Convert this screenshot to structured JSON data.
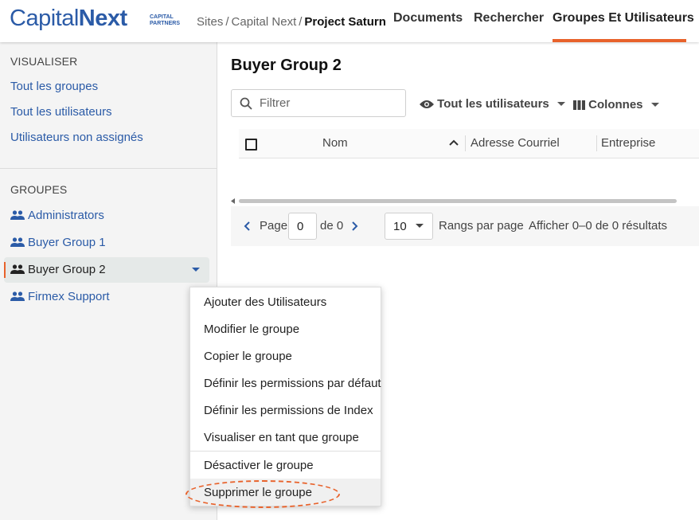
{
  "header": {
    "logo_regular": "Capital",
    "logo_bold": "Next",
    "logo_sub_line1": "CAPITAL",
    "logo_sub_line2": "PARTNERS",
    "breadcrumb": {
      "sites": "Sites",
      "sep": "/",
      "project": "Capital Next",
      "current": "Project Saturn"
    },
    "nav": {
      "documents": "Documents",
      "search": "Rechercher",
      "groups": "Groupes Et Utilisateurs"
    },
    "accent": "#e8622b"
  },
  "sidebar": {
    "view_heading": "VISUALISER",
    "view_links": [
      "Tout les groupes",
      "Tout les utilisateurs",
      "Utilisateurs non assignés"
    ],
    "groups_heading": "GROUPES",
    "groups": [
      "Administrators",
      "Buyer Group 1",
      "Buyer Group 2",
      "Firmex Support"
    ],
    "selected_group": "Buyer Group 2",
    "link_color": "#2b5ba7"
  },
  "main": {
    "title": "Buyer Group 2",
    "filter_placeholder": "Filtrer",
    "view_toggle": "Tout les utilisateurs",
    "columns_button": "Colonnes",
    "table_columns": [
      "Nom",
      "Adresse Courriel",
      "Entreprise"
    ],
    "pager": {
      "page_label": "Page",
      "page_value": "0",
      "of_label": "de 0",
      "page_size": "10",
      "rows_label": "Rangs par page",
      "results_label": "Afficher 0–0 de 0 résultats"
    }
  },
  "context_menu": {
    "items": [
      "Ajouter des Utilisateurs",
      "Modifier le groupe",
      "Copier le groupe",
      "Définir les permissions par défaut",
      "Définir les permissions de Index",
      "Visualiser en tant que groupe",
      "Désactiver le groupe",
      "Supprimer le groupe"
    ],
    "hovered": "Supprimer le groupe"
  }
}
